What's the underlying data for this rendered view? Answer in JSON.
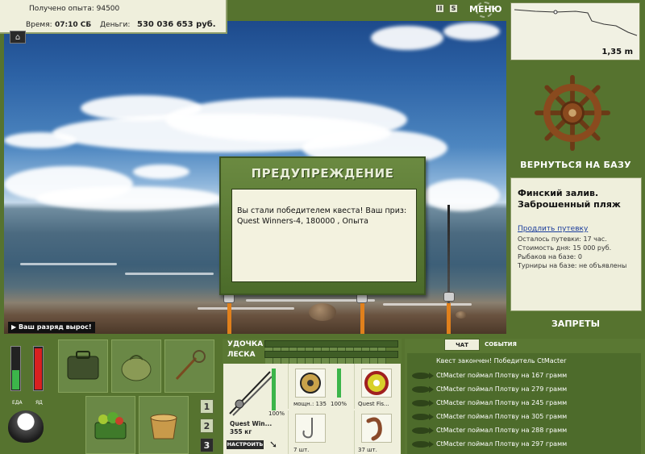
{
  "info": {
    "exp_label": "Получено опыта:",
    "exp_value": "94500",
    "time_label": "Время:",
    "time_value": "07:10 СБ",
    "money_label": "Деньги:",
    "money_value": "530 036 653 руб."
  },
  "top": {
    "btn_pause": "II",
    "btn_sound": "S",
    "menu_label": "МЕНЮ"
  },
  "depth": {
    "value": "1,35 m"
  },
  "right_panel": {
    "return_label": "ВЕРНУТЬСЯ НА БАЗУ",
    "location_title": "Финский залив. Заброшенный пляж",
    "extend_trip_label": "Продлить путевку",
    "lines": [
      "Осталось путевки: 17 час.",
      "Стоимость дня: 15 000 руб.",
      "Рыбаков на базе: 0",
      "Турниры на базе: не объявлены"
    ],
    "bans_label": "ЗАПРЕТЫ"
  },
  "rank_message": "Ваш разряд вырос!",
  "dialog": {
    "title": "ПРЕДУПРЕЖДЕНИЕ",
    "body": "Вы стали победителем квеста! Ваш приз: Quest Winners-4, 180000 , Опыта"
  },
  "stats": {
    "food_label": "ЕДА",
    "poison_label": "ЯД",
    "food_level": 0.45,
    "poison_level": 0.95
  },
  "pages": [
    "1",
    "2",
    "3"
  ],
  "tackle": {
    "rod_label": "УДОЧКА",
    "line_label": "ЛЕСКА",
    "rod_name": "Quest Win...",
    "rod_weight": "355 кг",
    "rod_percent": "100%",
    "reel_power": "мощн.: 135",
    "reel_percent": "100%",
    "line_name": "Quest Fis...",
    "hook_count": "7 шт.",
    "bait_count": "37 шт.",
    "tune_label": "НАСТРОИТЬ"
  },
  "events": {
    "tab_chat": "ЧАТ",
    "tab_events": "СОБЫТИЯ",
    "quest_line": "Квест закончен! Победитель CtMacter",
    "rows": [
      "CtMacter поймал Плотву на 167 грамм",
      "CtMacter поймал Плотву на 279 грамм",
      "CtMacter поймал Плотву на 245 грамм",
      "CtMacter поймал Плотву на 305 грамм",
      "CtMacter поймал Плотву на 288 грамм",
      "CtMacter поймал Плотву на 297 грамм"
    ]
  }
}
